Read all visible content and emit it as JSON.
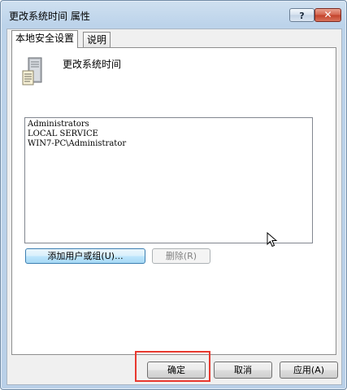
{
  "window": {
    "title": "更改系统时间 属性",
    "help_label": "?",
    "close_label": "✕"
  },
  "tabs": [
    {
      "label": "本地安全设置",
      "active": true
    },
    {
      "label": "说明",
      "active": false
    }
  ],
  "policy": {
    "icon": "server-icon",
    "title": "更改系统时间"
  },
  "accounts": [
    "Administrators",
    "LOCAL SERVICE",
    "WIN7-PC\\Administrator"
  ],
  "buttons": {
    "add": "添加用户或组(U)...",
    "remove": "删除(R)",
    "ok": "确定",
    "cancel": "取消",
    "apply": "应用(A)"
  },
  "colors": {
    "highlight": "#e8392f",
    "titlebar": "#bcd3ea"
  }
}
